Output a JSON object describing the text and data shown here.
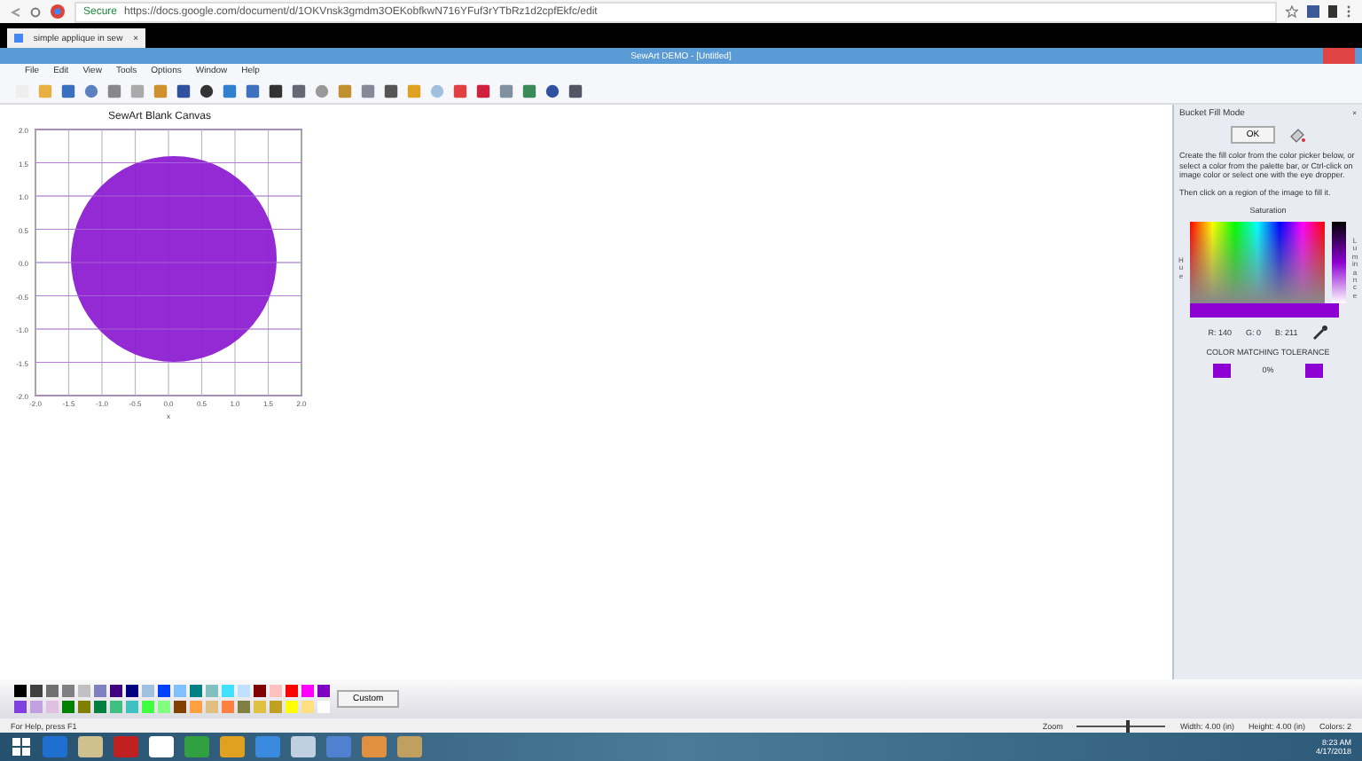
{
  "browser": {
    "secure_label": "Secure",
    "url": "https://docs.google.com/document/d/1OKVnsk3gmdm3OEKobfkwN716YFuf3rYTbRz1d2cpfEkfc/edit",
    "tab": {
      "title": "simple applique in sew",
      "close": "×"
    }
  },
  "window": {
    "title": "SewArt DEMO - [Untitled]"
  },
  "menu": [
    "File",
    "Edit",
    "View",
    "Tools",
    "Options",
    "Window",
    "Help"
  ],
  "canvas": {
    "title": "SewArt Blank Canvas",
    "yticks": [
      "2.0",
      "1.5",
      "1.0",
      "0.5",
      "0.0",
      "-0.5",
      "-1.0",
      "-1.5",
      "-2.0"
    ],
    "xticks": [
      "-2.0",
      "-1.5",
      "-1.0",
      "-0.5",
      "0.0",
      "0.5",
      "1.0",
      "1.5",
      "2.0"
    ],
    "xlabel": "x"
  },
  "panel": {
    "title": "Bucket Fill Mode",
    "close": "×",
    "ok": "OK",
    "instructions": "Create the fill color from the color picker below, or select a color from the palette bar, or Ctrl-click on image color or select one with the eye dropper.",
    "instructions_2": "Then click on a region of the image to fill it.",
    "saturation": "Saturation",
    "hue": "Hue",
    "luminance": "Luminance",
    "r": "R: 140",
    "g": "G: 0",
    "b": "B: 211",
    "tolerance_label": "COLOR MATCHING TOLERANCE",
    "tolerance": "0%"
  },
  "palette": {
    "colors": [
      {
        "color": "#000000"
      },
      {
        "color": "#404040"
      },
      {
        "color": "#707070"
      },
      {
        "color": "#808080"
      },
      {
        "color": "#c0c0c0"
      },
      {
        "color": "#8080c0"
      },
      {
        "color": "#400080"
      },
      {
        "color": "#000080"
      },
      {
        "color": "#a0c0e0"
      },
      {
        "color": "#0040ff"
      },
      {
        "color": "#80c0ff"
      },
      {
        "color": "#008080"
      },
      {
        "color": "#80c0c0"
      },
      {
        "color": "#40e0ff"
      },
      {
        "color": "#c0e0ff"
      },
      {
        "color": "#800000"
      },
      {
        "color": "#ffc0c0"
      },
      {
        "color": "#ff0000"
      },
      {
        "color": "#ff00ff"
      },
      {
        "color": "#8000c0"
      },
      {
        "color": "#8040e0"
      },
      {
        "color": "#c0a0e0"
      },
      {
        "color": "#e0c0e0"
      },
      {
        "color": "#008000"
      },
      {
        "color": "#808000"
      },
      {
        "color": "#008040"
      },
      {
        "color": "#40c080"
      },
      {
        "color": "#40c0c0"
      },
      {
        "color": "#40ff40"
      },
      {
        "color": "#80ff80"
      },
      {
        "color": "#804000"
      },
      {
        "color": "#ffa040"
      },
      {
        "color": "#e0c080"
      },
      {
        "color": "#ff8040"
      },
      {
        "color": "#808040"
      },
      {
        "color": "#e0c040"
      },
      {
        "color": "#c0a020"
      },
      {
        "color": "#ffff00"
      },
      {
        "color": "#ffe080"
      },
      {
        "color": "#ffffff"
      }
    ],
    "custom": "Custom"
  },
  "status_bar": {
    "help": "For Help, press F1",
    "zoom_label": "Zoom",
    "zoom": {
      "level": 0.55
    },
    "width": "Width: 4.00 (in)",
    "height": "Height: 4.00 (in)",
    "colors": "Colors: 2"
  },
  "taskbar": {
    "time": "8:23 AM",
    "date": "4/17/2018"
  }
}
